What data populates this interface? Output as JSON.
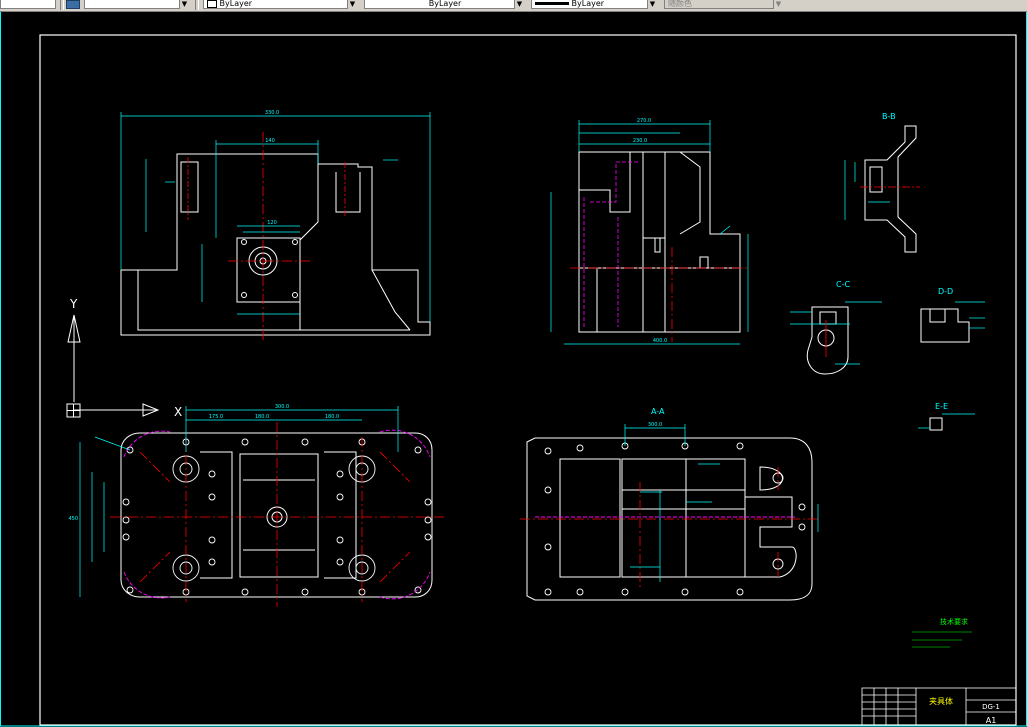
{
  "toolbar": {
    "layer_value": "",
    "color_value": "ByLayer",
    "linetype_value": "ByLayer",
    "lineweight_value": "ByLayer",
    "plotstyle_value": "随颜色"
  },
  "ucs": {
    "y_label": "Y",
    "x_label": "X"
  },
  "views": {
    "section_bb": "B-B",
    "section_cc": "C-C",
    "section_dd": "D-D",
    "section_aa": "A-A",
    "section_ee": "E-E"
  },
  "dimensions": {
    "front_width": "330.0",
    "front_inner": "140",
    "front_small": "120",
    "side_width": "270.0",
    "side_inner": "230.0",
    "side_bottom": "400.0",
    "plan_width": "300.0",
    "plan_part1": "175.0",
    "plan_part2": "180.0",
    "plan_part3": "180.0",
    "plan_height": "450",
    "section_width": "300.0"
  },
  "notes": {
    "title": "技术要求"
  },
  "title_block": {
    "name": "夹具体",
    "school": "",
    "drawing_no": "DG-1",
    "sheet": "A1"
  },
  "colors": {
    "border": "#00ffff",
    "geometry": "#ffffff",
    "center": "#ff0000",
    "dimension": "#00ffff",
    "hidden": "#ff00ff",
    "text": "#00ff00",
    "ucs": "#ffffff"
  }
}
